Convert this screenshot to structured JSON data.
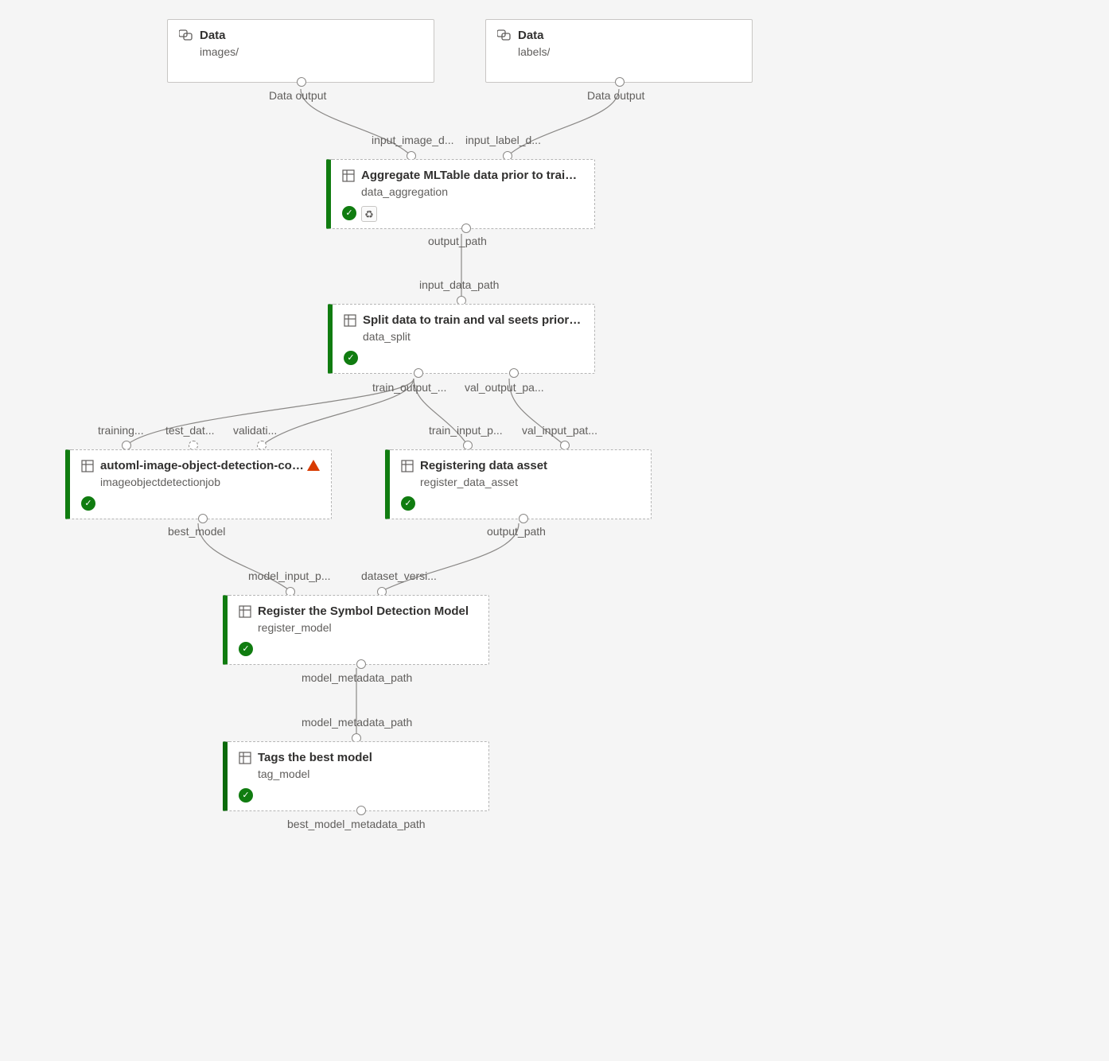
{
  "data_nodes": [
    {
      "id": "data_images",
      "title": "Data",
      "subtitle": "images/",
      "out_label": "Data output"
    },
    {
      "id": "data_labels",
      "title": "Data",
      "subtitle": "labels/",
      "out_label": "Data output"
    }
  ],
  "step_nodes": [
    {
      "id": "agg",
      "title": "Aggregate MLTable data prior to training",
      "subtitle": "data_aggregation",
      "badges": [
        "success",
        "cache"
      ],
      "warn": false,
      "in_labels": [
        "input_image_d...",
        "input_label_d..."
      ],
      "out_labels": [
        "output_path"
      ]
    },
    {
      "id": "split",
      "title": "Split data to train and val seets prior to t...",
      "subtitle": "data_split",
      "badges": [
        "success"
      ],
      "warn": false,
      "in_labels": [
        "input_data_path"
      ],
      "out_labels": [
        "train_output_...",
        "val_output_pa..."
      ]
    },
    {
      "id": "automl",
      "title": "automl-image-object-detection-comp...",
      "subtitle": "imageobjectdetectionjob",
      "badges": [
        "success"
      ],
      "warn": true,
      "in_labels": [
        "training...",
        "test_dat...",
        "validati..."
      ],
      "out_labels": [
        "best_model"
      ]
    },
    {
      "id": "regdata",
      "title": "Registering data asset",
      "subtitle": "register_data_asset",
      "badges": [
        "success"
      ],
      "warn": false,
      "in_labels": [
        "train_input_p...",
        "val_input_pat..."
      ],
      "out_labels": [
        "output_path"
      ]
    },
    {
      "id": "regmodel",
      "title": "Register the Symbol Detection Model",
      "subtitle": "register_model",
      "badges": [
        "success"
      ],
      "warn": false,
      "in_labels": [
        "model_input_p...",
        "dataset_versi..."
      ],
      "out_labels": [
        "model_metadata_path"
      ]
    },
    {
      "id": "tag",
      "title": "Tags the best model",
      "subtitle": "tag_model",
      "badges": [
        "success"
      ],
      "warn": false,
      "in_labels": [
        "model_metadata_path"
      ],
      "out_labels": [
        "best_model_metadata_path"
      ]
    }
  ]
}
